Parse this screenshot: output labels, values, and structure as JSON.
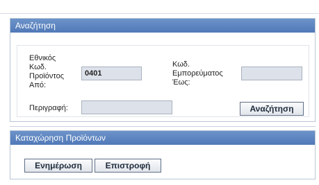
{
  "search_panel": {
    "title": "Αναζήτηση",
    "national_product_code_from_label_lines": [
      "Εθνικός",
      "Κωδ.",
      "Προϊόντος",
      "Από:"
    ],
    "national_product_code_from_value": "0401",
    "merchandise_code_to_label_lines": [
      "Κωδ.",
      "Εμπορεύματος",
      "Έως:"
    ],
    "merchandise_code_to_value": "",
    "description_label": "Περιγραφή:",
    "description_value": "",
    "search_button_label": "Αναζήτηση"
  },
  "register_panel": {
    "title": "Καταχώρηση Προϊόντων",
    "update_button_label": "Ενημέρωση",
    "return_button_label": "Επιστροφή"
  },
  "colors": {
    "header_blue": "#5b84c2",
    "input_bg": "#dde2ea",
    "button_border": "#5f6f86"
  }
}
